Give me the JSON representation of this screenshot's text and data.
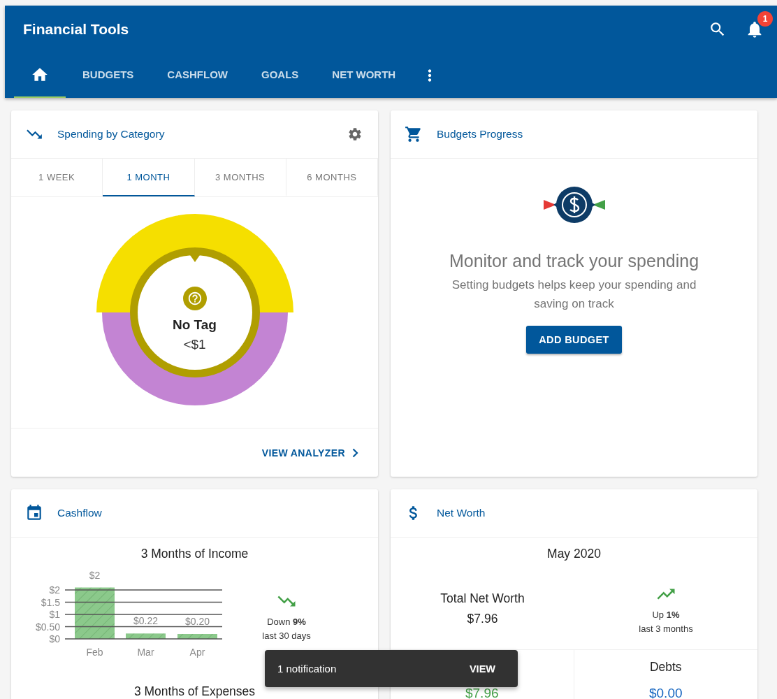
{
  "app_bar": {
    "title": "Financial Tools",
    "notification_count": "1"
  },
  "nav_tabs": [
    {
      "kind": "home",
      "selected": true
    },
    {
      "kind": "text",
      "label": "BUDGETS",
      "selected": false
    },
    {
      "kind": "text",
      "label": "CASHFLOW",
      "selected": false
    },
    {
      "kind": "text",
      "label": "GOALS",
      "selected": false
    },
    {
      "kind": "text",
      "label": "NET WORTH",
      "selected": false
    }
  ],
  "spending_card": {
    "title": "Spending by Category",
    "periods": [
      {
        "label": "1 WEEK",
        "selected": false
      },
      {
        "label": "1 MONTH",
        "selected": true
      },
      {
        "label": "3 MONTHS",
        "selected": false
      },
      {
        "label": "6 MONTHS",
        "selected": false
      }
    ],
    "donut": {
      "category": "No Tag",
      "amount": "<$1"
    },
    "link": "VIEW ANALYZER"
  },
  "budgets_card": {
    "title": "Budgets Progress",
    "heading": "Monitor and track your spending",
    "text": "Setting budgets helps keep your spending and saving on track",
    "button": "ADD BUDGET"
  },
  "cashflow_card": {
    "title": "Cashflow",
    "income": {
      "title": "3 Months of Income",
      "chart_data": {
        "type": "bar",
        "categories": [
          "Feb",
          "Mar",
          "Apr"
        ],
        "values": [
          2.1,
          0.22,
          0.2
        ],
        "ylim": [
          0,
          2.1
        ],
        "grid": true,
        "yticks": [
          {
            "value": 0,
            "label": "$0"
          },
          {
            "value": 0.5,
            "label": "$0.50"
          },
          {
            "value": 1,
            "label": "$1"
          },
          {
            "value": 1.5,
            "label": "$1.5"
          },
          {
            "value": 2,
            "label": "$2"
          }
        ],
        "value_labels": [
          "$2",
          "$0.22",
          "$0.20"
        ]
      },
      "trend": {
        "kind": "down",
        "text": "Down **9%**",
        "period": "last 30 days"
      }
    },
    "expenses_title": "3 Months of Expenses"
  },
  "net_worth_card": {
    "title": "Net Worth",
    "month": "May 2020",
    "total_label": "Total Net Worth",
    "total": "$7.96",
    "trend": {
      "kind": "up",
      "text": "Up **1%**",
      "period": "last 3 months"
    },
    "cells": [
      {
        "kind": "asset",
        "value": "$7.96"
      },
      {
        "kind": "debt",
        "label": "Debts",
        "value": "$0.00"
      }
    ]
  },
  "snackbar": {
    "message": "1 notification",
    "action": "VIEW"
  }
}
